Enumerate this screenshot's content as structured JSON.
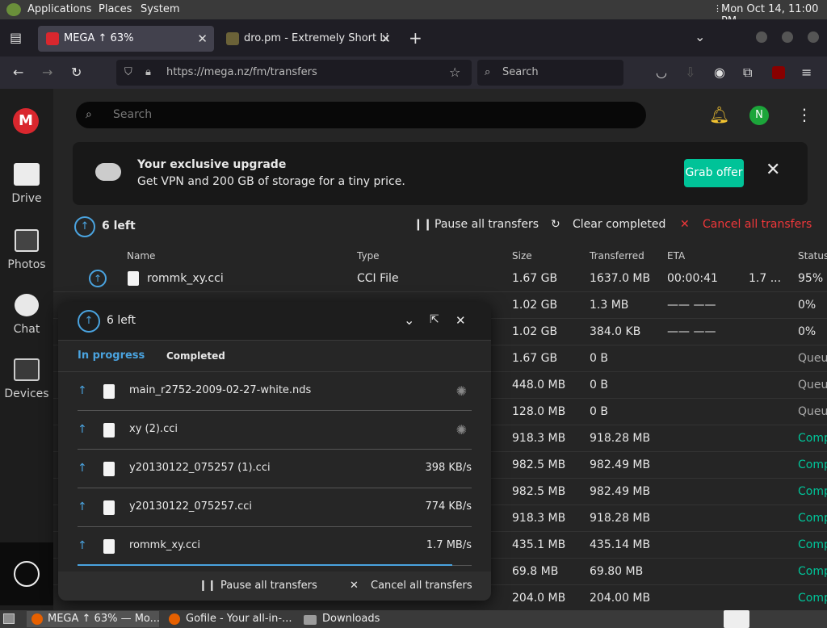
{
  "panel": {
    "applications": "Applications",
    "places": "Places",
    "system": "System",
    "clock": "Mon Oct 14, 11:00 PM"
  },
  "tabs": [
    {
      "label": "MEGA ↑ 63%"
    },
    {
      "label": "dro.pm - Extremely Short Li"
    }
  ],
  "nav": {
    "url": "https://mega.nz/fm/transfers",
    "search_placeholder": "Search"
  },
  "mega": {
    "search_placeholder": "Search",
    "avatar": "N",
    "sidebar": [
      {
        "label": "Drive"
      },
      {
        "label": "Photos"
      },
      {
        "label": "Chat"
      },
      {
        "label": "Devices"
      }
    ],
    "promo": {
      "title": "Your exclusive upgrade",
      "text": "Get VPN and 200 GB of storage for a tiny price.",
      "button": "Grab offer"
    },
    "transfers_left": "6 left",
    "actions": {
      "pause": "Pause all transfers",
      "clear": "Clear completed",
      "cancel": "Cancel all transfers"
    },
    "columns": {
      "name": "Name",
      "type": "Type",
      "size": "Size",
      "transferred": "Transferred",
      "eta": "ETA",
      "status": "Status"
    },
    "rows": [
      {
        "name": "rommk_xy.cci",
        "type": "CCI File",
        "size": "1.67 GB",
        "transferred": "1637.0 MB",
        "eta": "00:00:41",
        "speed": "1.7 ...",
        "status": "95%"
      },
      {
        "size": "1.02 GB",
        "transferred": "1.3 MB",
        "eta": "—— ——",
        "status": "0%"
      },
      {
        "size": "1.02 GB",
        "transferred": "384.0 KB",
        "eta": "—— ——",
        "status": "0%"
      },
      {
        "size": "1.67 GB",
        "transferred": "0 B",
        "status": "Queu"
      },
      {
        "size": "448.0 MB",
        "transferred": "0 B",
        "status": "Queu"
      },
      {
        "size": "128.0 MB",
        "transferred": "0 B",
        "status": "Queu"
      },
      {
        "size": "918.3 MB",
        "transferred": "918.28 MB",
        "status": "Comp"
      },
      {
        "size": "982.5 MB",
        "transferred": "982.49 MB",
        "status": "Comp"
      },
      {
        "size": "982.5 MB",
        "transferred": "982.49 MB",
        "status": "Comp"
      },
      {
        "size": "918.3 MB",
        "transferred": "918.28 MB",
        "status": "Comp"
      },
      {
        "size": "435.1 MB",
        "transferred": "435.14 MB",
        "status": "Comp"
      },
      {
        "size": "69.8 MB",
        "transferred": "69.80 MB",
        "status": "Comp"
      },
      {
        "size": "204.0 MB",
        "transferred": "204.00 MB",
        "status": "Comp"
      }
    ]
  },
  "popup": {
    "title": "6 left",
    "tab_in_progress": "In progress",
    "tab_completed": "Completed",
    "items": [
      {
        "name": "main_r2752-2009-02-27-white.nds",
        "speed": ""
      },
      {
        "name": "xy (2).cci",
        "speed": ""
      },
      {
        "name": "y20130122_075257 (1).cci",
        "speed": "398 KB/s"
      },
      {
        "name": "y20130122_075257.cci",
        "speed": "774 KB/s"
      },
      {
        "name": "rommk_xy.cci",
        "speed": "1.7 MB/s",
        "progress": 95
      }
    ],
    "pause": "Pause all transfers",
    "cancel": "Cancel all transfers"
  },
  "taskbar": [
    {
      "label": "MEGA ↑ 63% — Mo..."
    },
    {
      "label": "Gofile - Your all-in-..."
    },
    {
      "label": "Downloads"
    }
  ],
  "colors": {
    "accent": "#00c398",
    "brand": "#d9272e",
    "cancel": "#f0373a",
    "blue": "#4aa3df"
  }
}
